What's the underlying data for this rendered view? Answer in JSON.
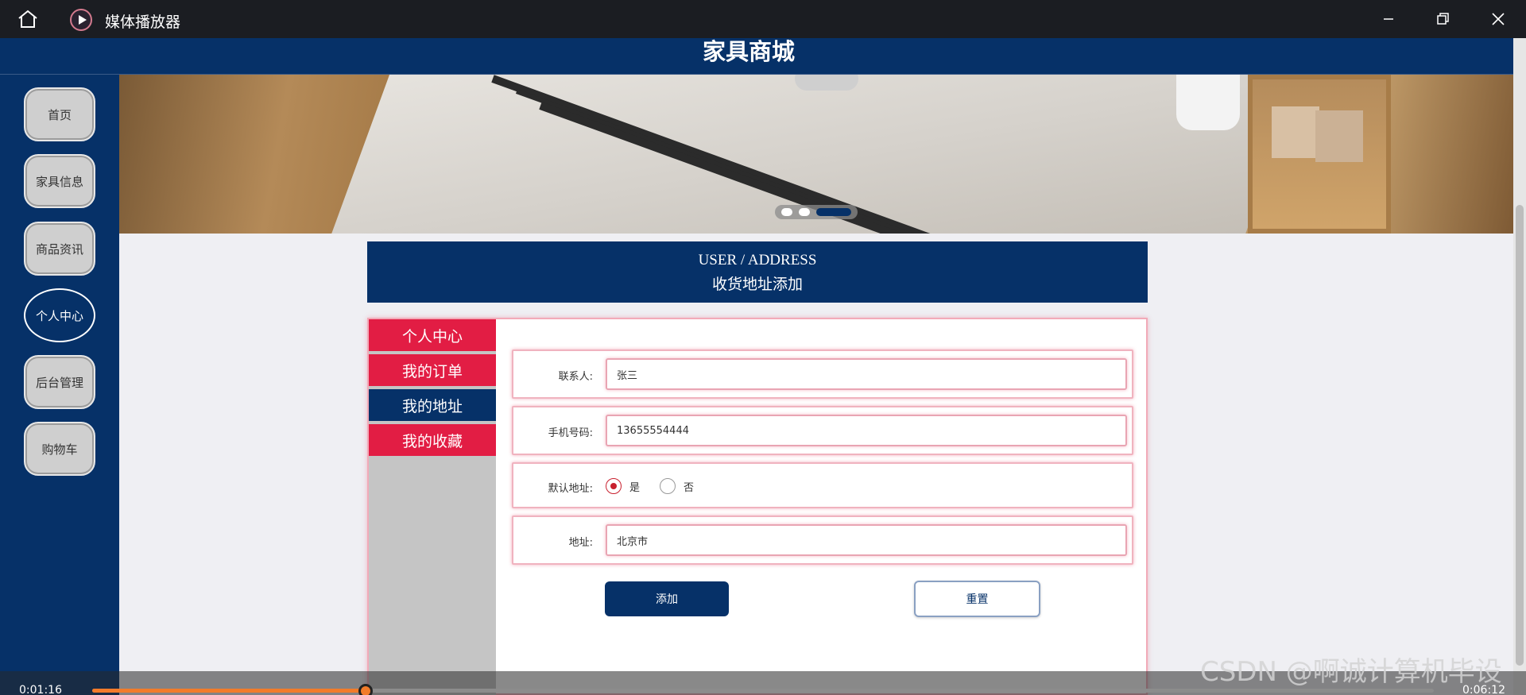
{
  "window": {
    "app_title": "媒体播放器",
    "icons": {
      "home": "home-icon",
      "app": "play-icon",
      "minimize": "minimize-icon",
      "maximize": "restore-icon",
      "close": "close-icon"
    }
  },
  "site": {
    "title": "家具商城"
  },
  "nav": {
    "items": [
      {
        "label": "首页"
      },
      {
        "label": "家具信息"
      },
      {
        "label": "商品资讯"
      },
      {
        "label": "个人中心",
        "active": true
      },
      {
        "label": "后台管理"
      },
      {
        "label": "购物车"
      }
    ]
  },
  "banner": {
    "slide_count": 3,
    "active_slide": 3
  },
  "heading": {
    "en": "USER / ADDRESS",
    "cn": "收货地址添加"
  },
  "side_menu": {
    "items": [
      {
        "label": "个人中心"
      },
      {
        "label": "我的订单"
      },
      {
        "label": "我的地址",
        "active": true
      },
      {
        "label": "我的收藏"
      }
    ]
  },
  "form": {
    "contact": {
      "label": "联系人:",
      "value": "张三"
    },
    "phone": {
      "label": "手机号码:",
      "value": "13655554444"
    },
    "default_address": {
      "label": "默认地址:",
      "options": [
        {
          "label": "是",
          "checked": true
        },
        {
          "label": "否",
          "checked": false
        }
      ]
    },
    "address": {
      "label": "地址:",
      "value": "北京市"
    },
    "add_label": "添加",
    "reset_label": "重置"
  },
  "player": {
    "current_time": "0:01:16",
    "total_time": "0:06:12",
    "progress": 0.204
  },
  "watermark": "CSDN @啊诚计算机毕设",
  "colors": {
    "primary": "#063168",
    "accent": "#e21d44",
    "seek": "#f27b2a"
  }
}
